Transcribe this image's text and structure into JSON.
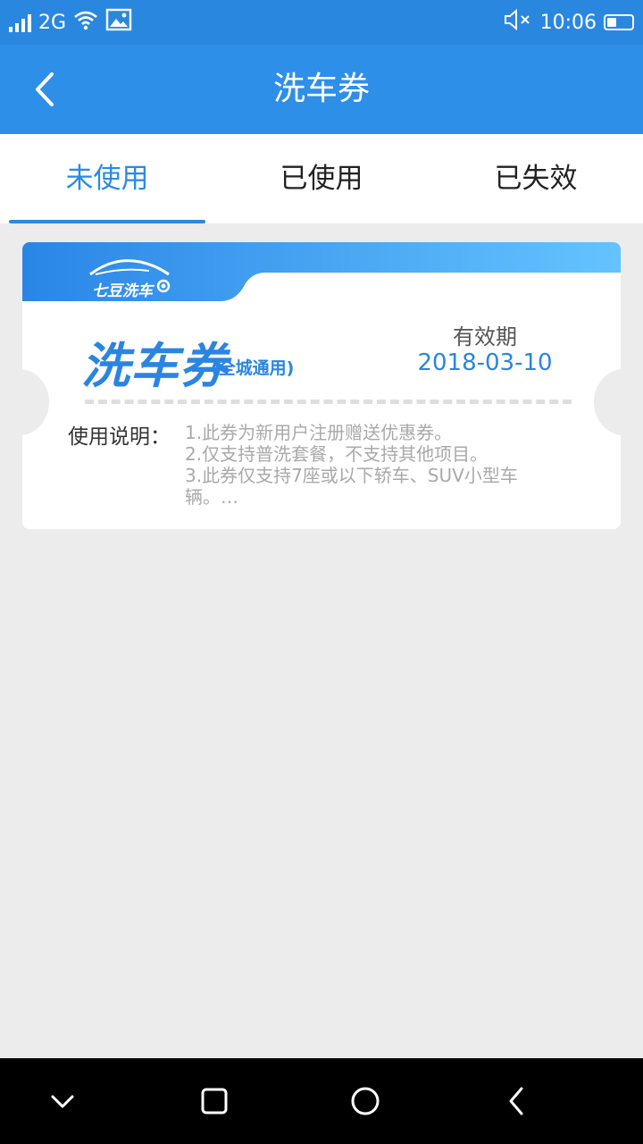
{
  "status_bar": {
    "network": "2G",
    "time": "10:06",
    "icons": [
      "signal-icon",
      "wifi-icon",
      "image-icon",
      "mute-icon",
      "battery-icon"
    ]
  },
  "app_bar": {
    "title": "洗车券",
    "back_icon": "chevron-left-icon"
  },
  "tabs": [
    {
      "label": "未使用",
      "active": true
    },
    {
      "label": "已使用",
      "active": false
    },
    {
      "label": "已失效",
      "active": false
    }
  ],
  "coupon": {
    "brand": "七豆洗车",
    "title": "洗车券",
    "scope": "(全城通用)",
    "validity_label": "有效期",
    "validity_date": "2018-03-10",
    "usage_label": "使用说明：",
    "usage_lines": [
      "1.此券为新用户注册赠送优惠券。",
      "2.仅支持普洗套餐，不支持其他项目。",
      "3.此券仅支持7座或以下轿车、SUV小型车",
      "辆。…"
    ]
  },
  "nav_bar": {
    "buttons": [
      "chevron-down-icon",
      "square-icon",
      "circle-icon",
      "back-triangle-icon"
    ]
  },
  "colors": {
    "status_bar": "#2a87e0",
    "app_bar": "#2e8fe8",
    "accent": "#2a8ae6",
    "page_background": "#ececec"
  }
}
